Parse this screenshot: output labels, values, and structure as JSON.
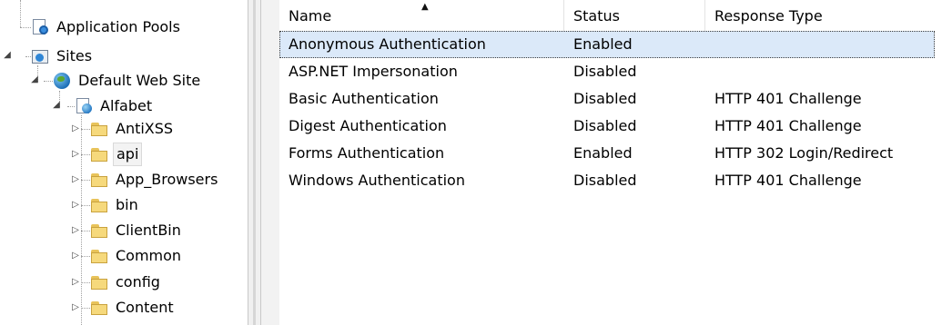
{
  "tree": {
    "application_pools": "Application Pools",
    "sites": "Sites",
    "default_web_site": "Default Web Site",
    "alfabet": "Alfabet",
    "folders": [
      {
        "label": "AntiXSS"
      },
      {
        "label": "api",
        "selected": true
      },
      {
        "label": "App_Browsers"
      },
      {
        "label": "bin"
      },
      {
        "label": "ClientBin"
      },
      {
        "label": "Common"
      },
      {
        "label": "config"
      },
      {
        "label": "Content"
      }
    ],
    "collapsed_glyph": "▷",
    "expanded_glyph": "◢"
  },
  "list": {
    "columns": [
      "Name",
      "Status",
      "Response Type"
    ],
    "sort_indicator": "▲",
    "rows": [
      {
        "name": "Anonymous Authentication",
        "status": "Enabled",
        "response_type": "",
        "selected": true
      },
      {
        "name": "ASP.NET Impersonation",
        "status": "Disabled",
        "response_type": ""
      },
      {
        "name": "Basic Authentication",
        "status": "Disabled",
        "response_type": "HTTP 401 Challenge"
      },
      {
        "name": "Digest Authentication",
        "status": "Disabled",
        "response_type": "HTTP 401 Challenge"
      },
      {
        "name": "Forms Authentication",
        "status": "Enabled",
        "response_type": "HTTP 302 Login/Redirect"
      },
      {
        "name": "Windows Authentication",
        "status": "Disabled",
        "response_type": "HTTP 401 Challenge"
      }
    ]
  },
  "colors": {
    "selection": "#dbe9f9",
    "gutter": "#f2f2f2",
    "splitter": "#f0f0f0"
  },
  "icons": {
    "application_pools": "application-pools-icon",
    "sites": "sites-icon",
    "website": "globe-icon",
    "application": "application-icon",
    "folder": "folder-icon"
  }
}
